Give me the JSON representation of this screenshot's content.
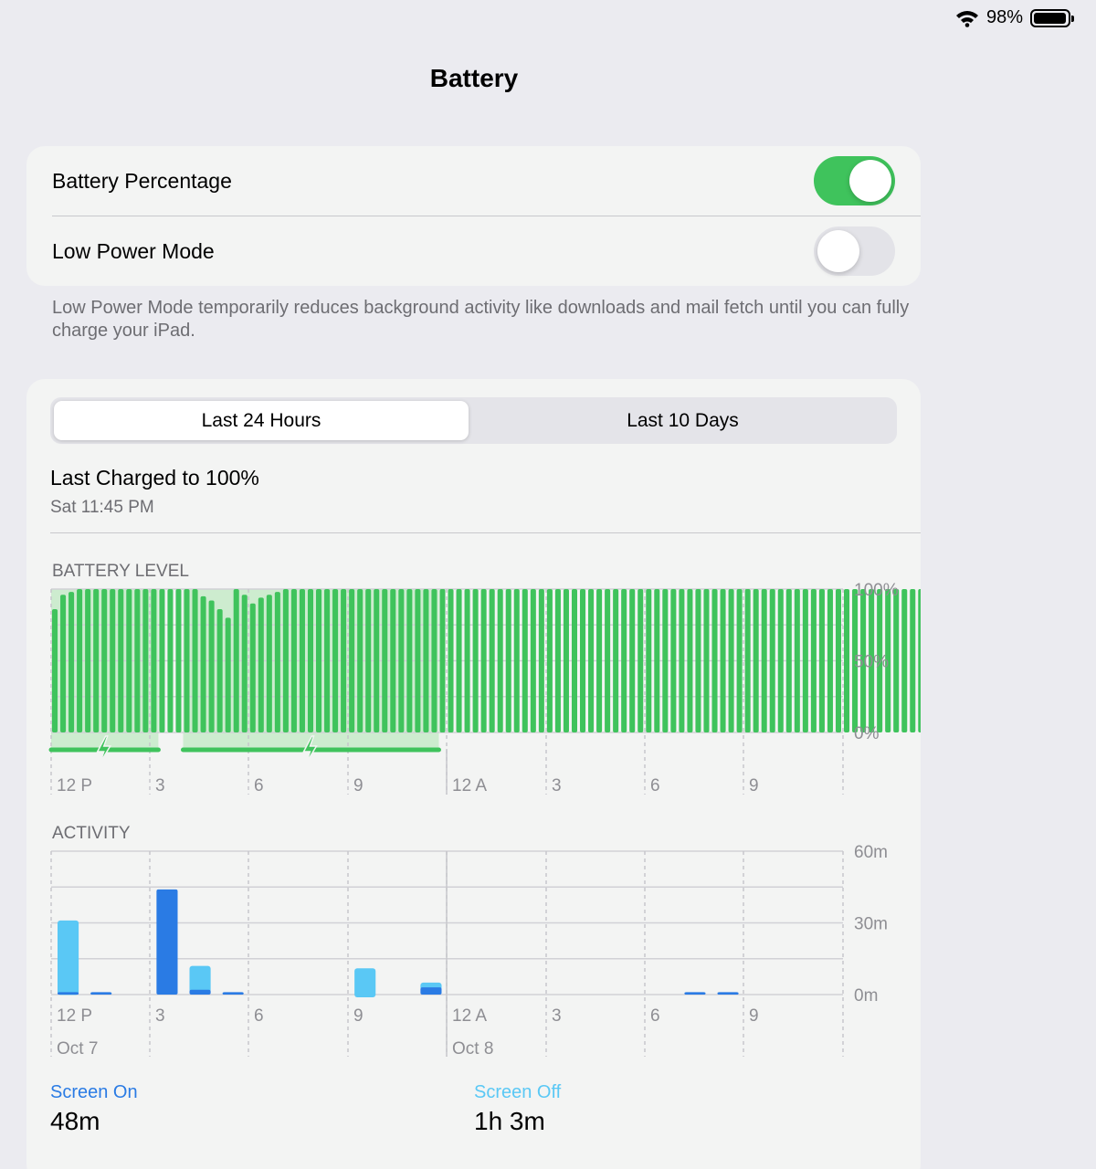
{
  "status_bar": {
    "battery_percent": "98%",
    "battery_level": 0.98,
    "icons": [
      "wifi-icon",
      "battery-icon"
    ]
  },
  "page": {
    "title": "Battery"
  },
  "settings": {
    "battery_percentage": {
      "label": "Battery Percentage",
      "on": true
    },
    "low_power_mode": {
      "label": "Low Power Mode",
      "on": false
    },
    "footnote": "Low Power Mode temporarily reduces background activity like downloads and mail fetch until you can fully charge your iPad."
  },
  "tabs": {
    "active": "Last 24 Hours",
    "inactive": "Last 10 Days"
  },
  "last_charged": {
    "title": "Last Charged to 100%",
    "time": "Sat 11:45 PM"
  },
  "battery_chart": {
    "label": "BATTERY LEVEL",
    "y_ticks": [
      "100%",
      "50%",
      "0%"
    ],
    "x_ticks": [
      "12 P",
      "3",
      "6",
      "9",
      "12 A",
      "3",
      "6",
      "9"
    ]
  },
  "activity_chart": {
    "label": "ACTIVITY",
    "y_ticks": [
      "60m",
      "30m",
      "0m"
    ],
    "x_ticks": [
      "12 P",
      "3",
      "6",
      "9",
      "12 A",
      "3",
      "6",
      "9"
    ],
    "date_labels": [
      "Oct 7",
      "Oct 8"
    ]
  },
  "totals": {
    "screen_on_label": "Screen On",
    "screen_on_value": "48m",
    "screen_off_label": "Screen Off",
    "screen_off_value": "1h 3m"
  },
  "colors": {
    "battery_green": "#3fc35c",
    "charging_shade": "#cdeccf",
    "screen_on_blue": "#2a7be4",
    "screen_off_blue": "#5ac8f5"
  },
  "chart_data": [
    {
      "type": "bar",
      "title": "BATTERY LEVEL",
      "ylabel": "",
      "ylim": [
        0,
        100
      ],
      "x_start": "12 P (Oct 7)",
      "interval_minutes": 15,
      "values": [
        86,
        96,
        98,
        100,
        100,
        100,
        100,
        100,
        100,
        100,
        100,
        100,
        100,
        100,
        100,
        100,
        100,
        100,
        95,
        92,
        86,
        80,
        100,
        96,
        90,
        94,
        96,
        98,
        100,
        100,
        100,
        100,
        100,
        100,
        100,
        100,
        100,
        100,
        100,
        100,
        100,
        100,
        100,
        100,
        100,
        100,
        100,
        100,
        100,
        100,
        100,
        100,
        100,
        100,
        100,
        100,
        100,
        100,
        100,
        100,
        100,
        100,
        100,
        100,
        100,
        100,
        100,
        100,
        100,
        100,
        100,
        100,
        100,
        100,
        100,
        100,
        100,
        100,
        100,
        100,
        100,
        100,
        100,
        100,
        100,
        100,
        100,
        100,
        100,
        100,
        100,
        100,
        100,
        100,
        100,
        100,
        100,
        100,
        100,
        100,
        100,
        100,
        100,
        100,
        100,
        100,
        100,
        100,
        100,
        100,
        99,
        99,
        99,
        99,
        99,
        99,
        99,
        99,
        98,
        98,
        98,
        98,
        98,
        98,
        98,
        98
      ],
      "charging_intervals": [
        [
          "12 P",
          "~3:20 P"
        ],
        [
          "~4:00 P",
          "~11:45 P"
        ]
      ]
    },
    {
      "type": "bar",
      "title": "ACTIVITY",
      "ylabel": "",
      "ylim": [
        0,
        60
      ],
      "categories": [
        "12-1P",
        "1-2P",
        "3-4P",
        "4-5P",
        "5-6P",
        "9-10P",
        "11P-12A",
        "7-8A",
        "8-9A"
      ],
      "series": [
        {
          "name": "Screen On",
          "values": [
            1,
            1,
            44,
            2,
            1,
            0,
            3,
            1,
            1
          ]
        },
        {
          "name": "Screen Off",
          "values": [
            30,
            0,
            0,
            10,
            0,
            11,
            2,
            0,
            0
          ]
        }
      ]
    }
  ]
}
